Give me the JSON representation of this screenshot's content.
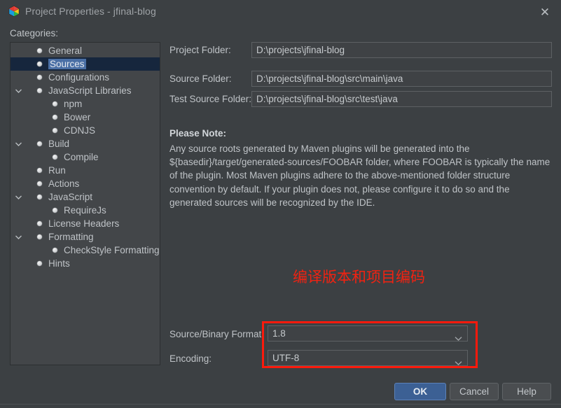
{
  "window": {
    "title": "Project Properties - jfinal-blog",
    "icon": "netbeans-cube-icon",
    "close_label": "✕"
  },
  "categories": {
    "label": "Categories:",
    "items": [
      {
        "label": "General",
        "indent": 0,
        "twisty": "none",
        "selected": false
      },
      {
        "label": "Sources",
        "indent": 0,
        "twisty": "none",
        "selected": true
      },
      {
        "label": "Configurations",
        "indent": 0,
        "twisty": "none",
        "selected": false
      },
      {
        "label": "JavaScript Libraries",
        "indent": 0,
        "twisty": "expanded",
        "selected": false
      },
      {
        "label": "npm",
        "indent": 1,
        "twisty": "none",
        "selected": false
      },
      {
        "label": "Bower",
        "indent": 1,
        "twisty": "none",
        "selected": false
      },
      {
        "label": "CDNJS",
        "indent": 1,
        "twisty": "none",
        "selected": false
      },
      {
        "label": "Build",
        "indent": 0,
        "twisty": "expanded",
        "selected": false
      },
      {
        "label": "Compile",
        "indent": 1,
        "twisty": "none",
        "selected": false
      },
      {
        "label": "Run",
        "indent": 0,
        "twisty": "none",
        "selected": false
      },
      {
        "label": "Actions",
        "indent": 0,
        "twisty": "none",
        "selected": false
      },
      {
        "label": "JavaScript",
        "indent": 0,
        "twisty": "expanded",
        "selected": false
      },
      {
        "label": "RequireJs",
        "indent": 1,
        "twisty": "none",
        "selected": false
      },
      {
        "label": "License Headers",
        "indent": 0,
        "twisty": "none",
        "selected": false
      },
      {
        "label": "Formatting",
        "indent": 0,
        "twisty": "expanded",
        "selected": false
      },
      {
        "label": "CheckStyle Formatting",
        "indent": 1,
        "twisty": "none",
        "selected": false
      },
      {
        "label": "Hints",
        "indent": 0,
        "twisty": "none",
        "selected": false
      }
    ]
  },
  "sources": {
    "project_folder": {
      "label": "Project Folder:",
      "value": "D:\\projects\\jfinal-blog"
    },
    "source_folder": {
      "label": "Source Folder:",
      "value": "D:\\projects\\jfinal-blog\\src\\main\\java"
    },
    "test_source_folder": {
      "label": "Test Source Folder:",
      "value": "D:\\projects\\jfinal-blog\\src\\test\\java"
    },
    "note_title": "Please Note:",
    "note_body": "Any source roots generated by Maven plugins will be generated into the ${basedir}/target/generated-sources/FOOBAR folder, where FOOBAR is typically the name of the plugin. Most Maven plugins adhere to the above-mentioned folder structure convention by default. If your plugin does not, please configure it to do so and the generated sources will be recognized by the IDE.",
    "source_binary_format": {
      "label": "Source/Binary Format:",
      "value": "1.8"
    },
    "encoding": {
      "label": "Encoding:",
      "value": "UTF-8"
    }
  },
  "annotation": {
    "text": "编译版本和项目编码",
    "color": "#f22211",
    "highlight_color": "#fb1a0c"
  },
  "buttons": {
    "ok": "OK",
    "cancel": "Cancel",
    "help": "Help"
  }
}
